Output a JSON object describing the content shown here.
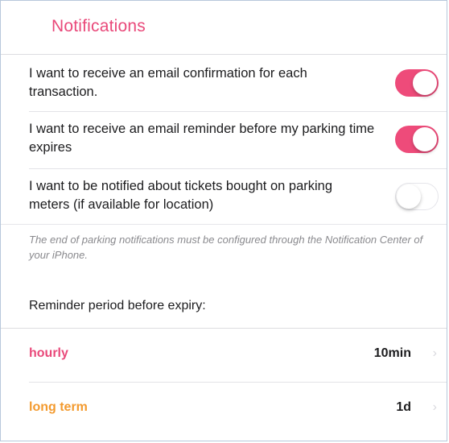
{
  "header": {
    "title": "Notifications"
  },
  "settings": [
    {
      "label": "I want to receive an email confirmation for each transaction.",
      "enabled": true
    },
    {
      "label": "I want to receive an email reminder before my parking time expires",
      "enabled": true
    },
    {
      "label": "I want to be notified about tickets bought on parking meters (if available for location)",
      "enabled": false
    }
  ],
  "note": "The end of parking notifications must be configured through the Notification Center of your iPhone.",
  "reminder": {
    "heading": "Reminder period before expiry:",
    "rows": [
      {
        "name": "hourly",
        "value": "10min",
        "name_color": "#e9497a"
      },
      {
        "name": "long term",
        "value": "1d",
        "name_color": "#f39a2e"
      }
    ]
  },
  "colors": {
    "accent": "#e9497a",
    "toggle_on": "#ee4b7a",
    "secondary": "#f39a2e"
  }
}
